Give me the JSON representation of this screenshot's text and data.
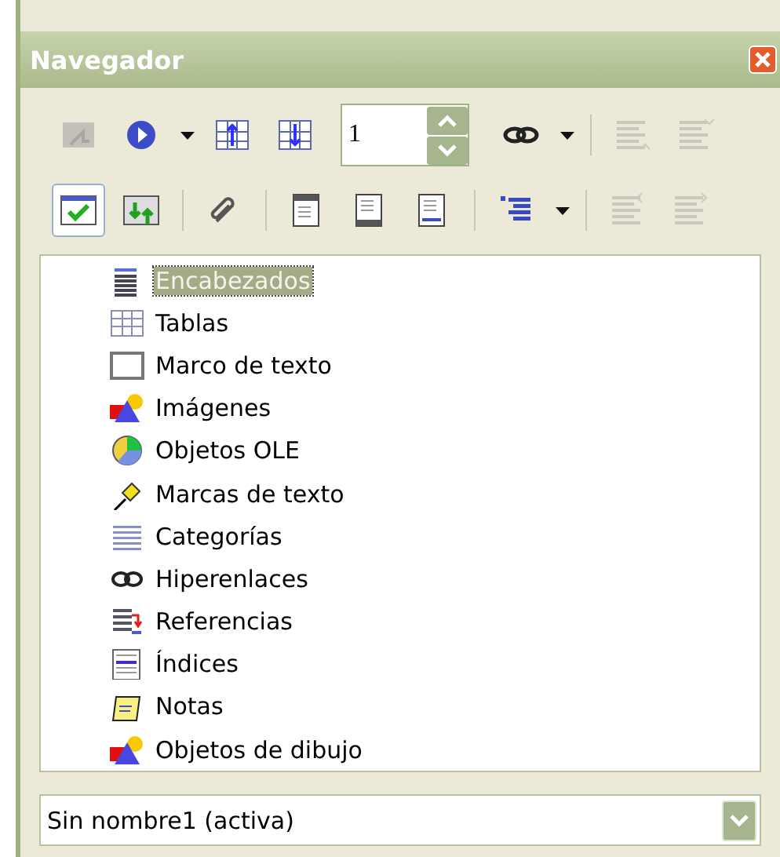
{
  "window": {
    "title": "Navegador"
  },
  "toolbar": {
    "rows": [
      [
        {
          "kind": "button",
          "disabled": true,
          "pressed": false
        },
        {
          "kind": "button",
          "disabled": false,
          "pressed": false
        },
        {
          "kind": "caret"
        },
        {
          "kind": "button",
          "disabled": false,
          "pressed": false
        },
        {
          "kind": "button",
          "disabled": false,
          "pressed": false
        },
        {
          "kind": "spin",
          "value": "1"
        },
        {
          "kind": "button",
          "disabled": false,
          "pressed": false
        },
        {
          "kind": "caret"
        },
        {
          "kind": "separator"
        },
        {
          "kind": "button",
          "disabled": true,
          "pressed": false
        },
        {
          "kind": "button",
          "disabled": true,
          "pressed": false
        }
      ],
      [
        {
          "kind": "button",
          "disabled": false,
          "pressed": true
        },
        {
          "kind": "button",
          "disabled": false,
          "pressed": false
        },
        {
          "kind": "separator"
        },
        {
          "kind": "button",
          "disabled": false,
          "pressed": false
        },
        {
          "kind": "separator"
        },
        {
          "kind": "button",
          "disabled": false,
          "pressed": false
        },
        {
          "kind": "button",
          "disabled": false,
          "pressed": false
        },
        {
          "kind": "button",
          "disabled": false,
          "pressed": false
        },
        {
          "kind": "separator"
        },
        {
          "kind": "button",
          "disabled": false,
          "pressed": false
        },
        {
          "kind": "caret"
        },
        {
          "kind": "separator"
        },
        {
          "kind": "button",
          "disabled": true,
          "pressed": false
        },
        {
          "kind": "button",
          "disabled": true,
          "pressed": false
        }
      ]
    ]
  },
  "tree": {
    "items": [
      {
        "label": "Encabezados",
        "selected": true
      },
      {
        "label": "Tablas",
        "selected": false
      },
      {
        "label": "Marco de texto",
        "selected": false
      },
      {
        "label": "Imágenes",
        "selected": false
      },
      {
        "label": "Objetos OLE",
        "selected": false
      },
      {
        "label": "Marcas de texto",
        "selected": false
      },
      {
        "label": "Categorías",
        "selected": false
      },
      {
        "label": "Hiperenlaces",
        "selected": false
      },
      {
        "label": "Referencias",
        "selected": false
      },
      {
        "label": "Índices",
        "selected": false
      },
      {
        "label": "Notas",
        "selected": false
      },
      {
        "label": "Objetos de dibujo",
        "selected": false
      }
    ]
  },
  "document_select": {
    "value": "Sin nombre1 (activa)"
  }
}
